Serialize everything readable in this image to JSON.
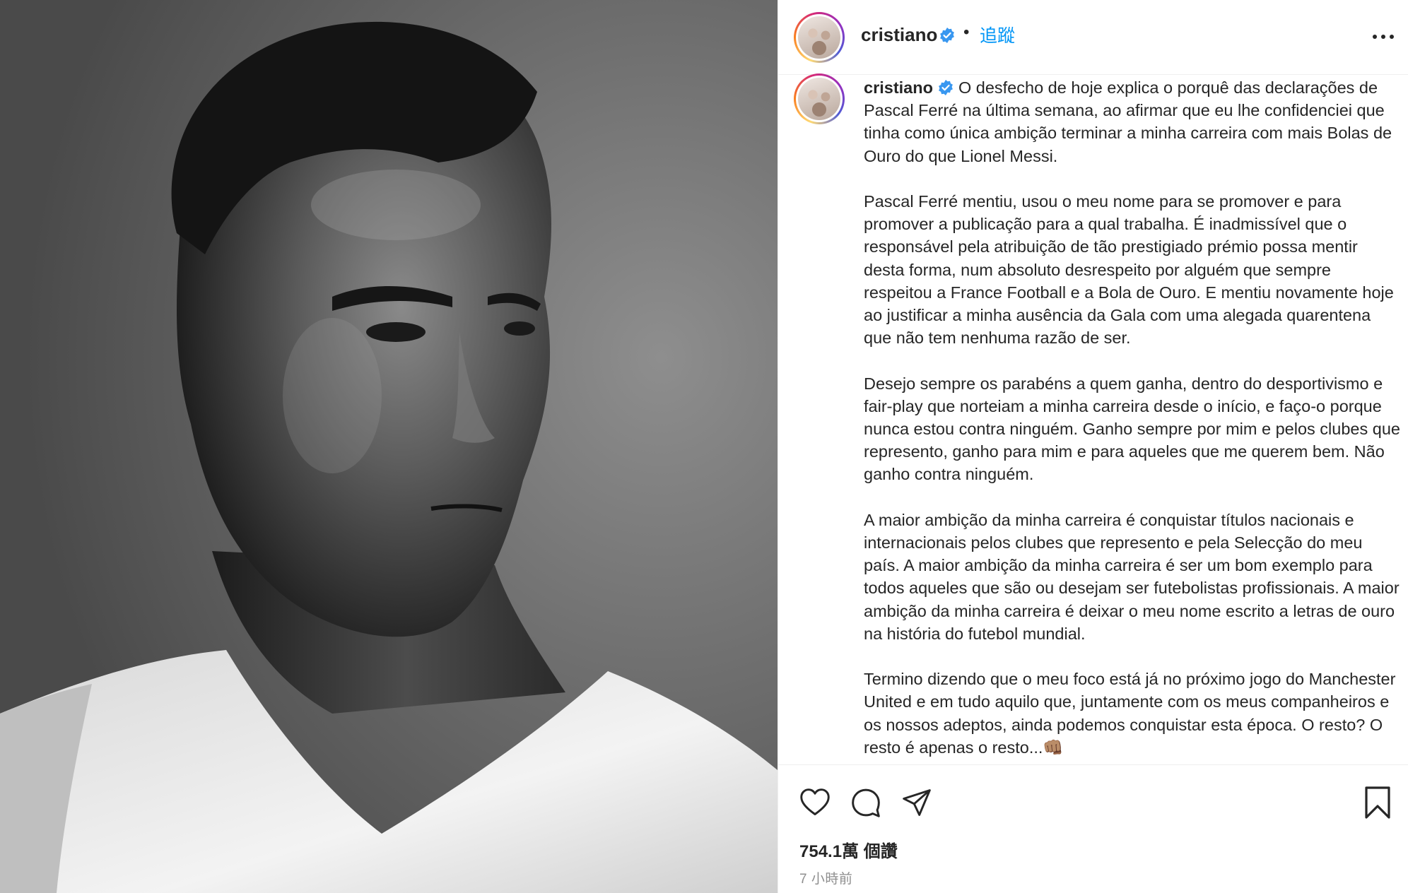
{
  "photo": {
    "alt_icon": "portrait-photo"
  },
  "header": {
    "username": "cristiano",
    "separator": "•",
    "follow_label": "追蹤"
  },
  "caption": {
    "username": "cristiano",
    "paragraphs": [
      "O desfecho de hoje explica o porquê das declarações de Pascal Ferré na última semana, ao afirmar que eu lhe confidenciei que tinha como única ambição terminar a minha carreira com mais Bolas de Ouro do que Lionel Messi.",
      "Pascal Ferré mentiu, usou o meu nome para se promover e para promover a publicação para a qual trabalha. É inadmissível que o responsável pela atribuição de tão prestigiado prémio possa mentir desta forma, num absoluto desrespeito por alguém que sempre respeitou a France Football e a Bola de Ouro. E mentiu novamente hoje ao justificar a minha ausência da Gala com uma alegada quarentena que não tem nenhuma razão de ser.",
      "Desejo sempre os parabéns a quem ganha, dentro do desportivismo e fair-play que norteiam a minha carreira desde o início, e faço-o porque nunca estou contra ninguém. Ganho sempre por mim e pelos clubes que represento, ganho para mim e para aqueles que me querem bem. Não ganho contra ninguém.",
      "A maior ambição da minha carreira é conquistar títulos nacionais e internacionais pelos clubes que represento e pela Selecção do meu país. A maior ambição da minha carreira é ser um bom exemplo para todos aqueles que são ou desejam ser futebolistas profissionais. A maior ambição da minha carreira é deixar o meu nome escrito a letras de ouro na história do futebol mundial.",
      "Termino dizendo que o meu foco está já no próximo jogo do Manchester United e em tudo aquilo que, juntamente com os meus companheiros e os nossos adeptos, ainda podemos conquistar esta época. O resto? O resto é apenas o resto...👊🏽"
    ]
  },
  "actions": {
    "icons": [
      "heart-icon",
      "comment-icon",
      "share-icon",
      "bookmark-icon"
    ],
    "likes": "754.1萬 個讚",
    "time": "7 小時前"
  },
  "colors": {
    "link": "#0095f6",
    "verified": "#3897f0",
    "text": "#262626",
    "muted": "#8e8e8e"
  }
}
